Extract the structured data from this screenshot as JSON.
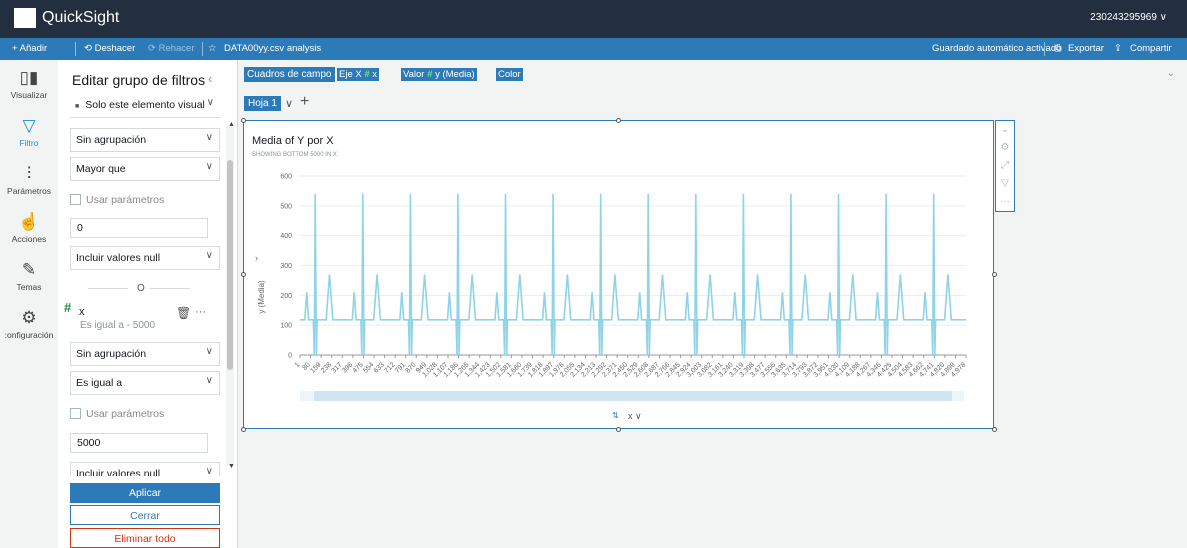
{
  "app": {
    "title": "QuickSight",
    "account": "230243295969 ∨"
  },
  "menubar": {
    "add": "+ Añadir",
    "undo": "⟲ Deshacer",
    "redo": "⟳ Rehacer",
    "star": "☆",
    "analysis": "DATA00yy.csv analysis",
    "autosave": "Guardado automático activado",
    "export": "Exportar",
    "share": "Compartir"
  },
  "nav": [
    {
      "label": "Visualizar",
      "icon": "bar-chart-icon"
    },
    {
      "label": "Filtro",
      "icon": "filter-icon"
    },
    {
      "label": "Parámetros",
      "icon": "sliders-icon"
    },
    {
      "label": "Acciones",
      "icon": "click-icon"
    },
    {
      "label": "Temas",
      "icon": "brush-icon"
    },
    {
      "label": ":onfiguración",
      "icon": "gear-icon"
    }
  ],
  "filter_panel": {
    "title": "Editar grupo de filtros",
    "scope": "Solo este elemento visual",
    "agg1": "Sin agrupación",
    "cond1": "Mayor que",
    "use_params": "Usar parámetros",
    "value1": "0",
    "null1": "Incluir valores null",
    "or": "O",
    "field": "x",
    "field_desc": "Es igual a - 5000",
    "agg2": "Sin agrupación",
    "cond2": "Es igual a",
    "value2": "5000",
    "null2": "Incluir valores null",
    "apply": "Aplicar",
    "close": "Cerrar",
    "delete": "Eliminar todo"
  },
  "field_wells": {
    "label": "Cuadros de campo",
    "xaxis": "Eje X",
    "xfield": "x",
    "value": "Valor",
    "vfield": "y (Media)",
    "color": "Color"
  },
  "sheet": {
    "tab": "Hoja 1"
  },
  "visual": {
    "title": "Media of Y por X",
    "subtitle": "SHOWING BOTTOM 5000 IN X",
    "x_control": "x ∨"
  },
  "chart_data": {
    "type": "line",
    "ylabel": "y (Media)",
    "ylim": [
      0,
      600
    ],
    "yticks": [
      0,
      100,
      200,
      300,
      400,
      500,
      600
    ],
    "grid": true,
    "series_color": "#8fd3e6",
    "xlabels": [
      "1",
      "80",
      "159",
      "238",
      "317",
      "396",
      "475",
      "554",
      "633",
      "712",
      "791",
      "870",
      "949",
      "1,028",
      "1,107",
      "1,186",
      "1,265",
      "1,344",
      "1,423",
      "1,502",
      "1,581",
      "1,660",
      "1,739",
      "1,818",
      "1,897",
      "1,976",
      "2,055",
      "2,134",
      "2,213",
      "2,292",
      "2,371",
      "2,450",
      "2,529",
      "2,608",
      "2,687",
      "2,766",
      "2,845",
      "2,924",
      "3,003",
      "3,082",
      "3,161",
      "3,240",
      "3,319",
      "3,398",
      "3,477",
      "3,556",
      "3,635",
      "3,714",
      "3,793",
      "3,872",
      "3,951",
      "4,030",
      "4,109",
      "4,188",
      "4,267",
      "4,346",
      "4,425",
      "4,504",
      "4,583",
      "4,662",
      "4,741",
      "4,820",
      "4,899",
      "4,978"
    ],
    "pattern": {
      "baseline": 118,
      "r_peak": 540,
      "p_wave": 210,
      "t_wave": 270,
      "q_dip": 0
    }
  },
  "colors": {
    "brand": "#232f3e",
    "accent": "#2d7ab8",
    "link": "#1a8fd4",
    "danger": "#d13212"
  }
}
